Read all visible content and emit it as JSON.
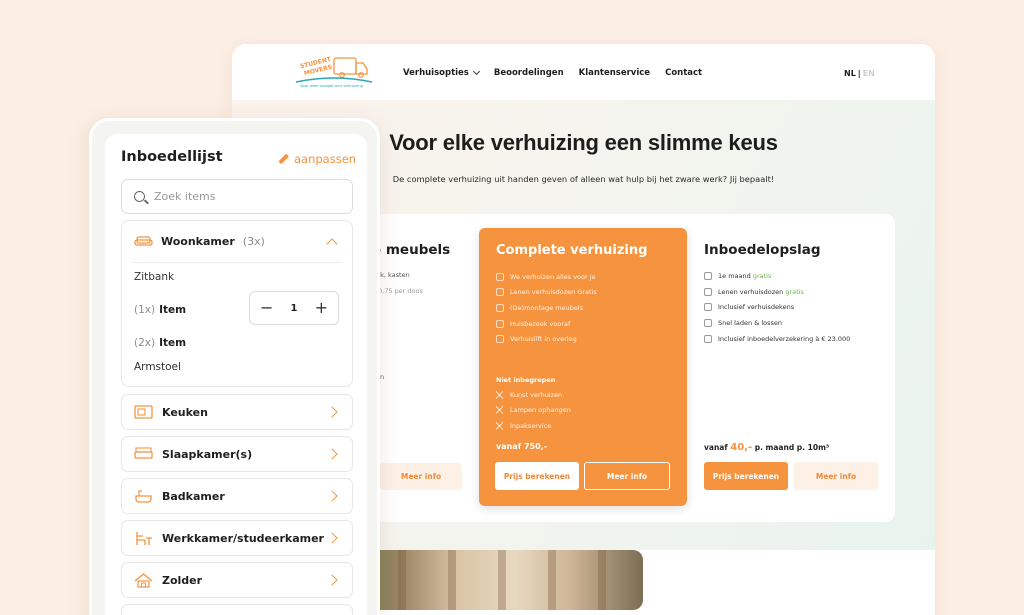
{
  "site": {
    "logo_text": "STUDENT MOVERS",
    "logo_tagline": "Voor weer budget een verhuizing",
    "nav": [
      "Verhuisopties",
      "Beoordelingen",
      "Klantenservice",
      "Contact"
    ],
    "lang_active": "NL",
    "lang_sep": "|",
    "lang_inactive": "EN",
    "hero_title": "Voor elke verhuizing een slimme keus",
    "hero_subtitle": "De complete verhuizing uit handen geven of alleen wat hulp bij het zware werk? Jij bepaalt!",
    "left_card": {
      "title": "e meubels",
      "line1": "ank, kasten",
      "line2": "0,75 per doos",
      "line3": "en",
      "more_info": "Meer info"
    },
    "main_card": {
      "title": "Complete verhuizing",
      "features": [
        "We verhuizen alles voor je",
        "Lenen verhuisdozen Gratis",
        "(De)montage meubels",
        "Huisbezoek vooraf",
        "Verhuislift in overleg"
      ],
      "excluded_heading": "Niet inbegrepen",
      "excluded": [
        "Kunst verhuizen",
        "Lampen ophangen",
        "Inpakservice"
      ],
      "price": "vanaf 750,-",
      "calc_button": "Prijs berekenen",
      "info_button": "Meer info"
    },
    "right_card": {
      "title": "Inboedelopslag",
      "features": [
        {
          "text": "1e maand ",
          "highlight": "gratis"
        },
        {
          "text": "Lenen verhuisdozen ",
          "highlight": "gratis"
        },
        {
          "text": "Inclusief verhuisdekens",
          "highlight": ""
        },
        {
          "text": "Snel laden & lossen",
          "highlight": ""
        },
        {
          "text": "Inclusief inboedelverzekering à € 23.000",
          "highlight": ""
        }
      ],
      "price_prefix": "vanaf ",
      "price_value": "40,-",
      "price_suffix": " p. maand p. 10m³",
      "calc_button": "Prijs berekenen",
      "info_button": "Meer info"
    }
  },
  "phone": {
    "title": "Inboedellijst",
    "edit": "aanpassen",
    "search_placeholder": "Zoek items",
    "open_room": {
      "name": "Woonkamer",
      "count": "(3x)",
      "items": [
        {
          "qty": "",
          "name": "Zitbank"
        },
        {
          "qty": "(1x)",
          "name": "Item"
        },
        {
          "qty": "(2x)",
          "name": "Item"
        },
        {
          "qty": "",
          "name": "Armstoel"
        }
      ],
      "stepper_value": "1"
    },
    "rooms": [
      "Keuken",
      "Slaapkamer(s)",
      "Badkamer",
      "Werkkamer/studeerkamer",
      "Zolder"
    ]
  },
  "colors": {
    "accent": "#f5933e",
    "green": "#6cb84a",
    "background": "#fbeee3"
  }
}
